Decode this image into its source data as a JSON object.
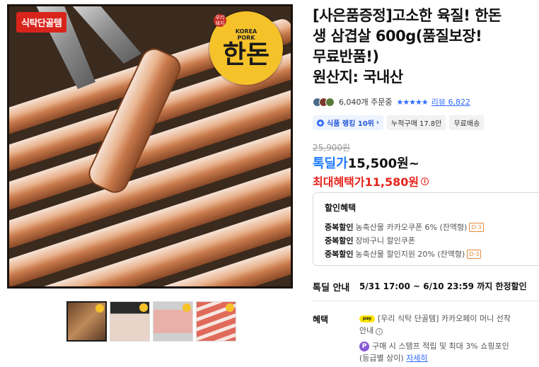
{
  "image": {
    "badge": "식탁단골템",
    "logo_korea": "KOREA",
    "logo_pork": "PORK",
    "logo_name": "한돈",
    "logo_corner": "우리돼지"
  },
  "product": {
    "title_lines": [
      "[사은품증정]고소한 육질! 한돈",
      "생 삼겹살 600g(품질보장!",
      "무료반품!)",
      "원산지: 국내산"
    ]
  },
  "reviews": {
    "order_count": "6,040개 주문중",
    "stars": "★★★★★",
    "review_link": "리뷰 6,822"
  },
  "tags": {
    "rank": "식품 랭킹 10위",
    "rank_arrow": "›",
    "cumulative": "누적구매 17.8만",
    "shipping": "무료배송"
  },
  "price": {
    "original": "25,900원",
    "deal_label": "톡딜가",
    "deal_value": "15,500원~",
    "max_label": "최대혜택가",
    "max_value": "11,580원"
  },
  "discount": {
    "header": "할인혜택",
    "rows": [
      {
        "label": "중복할인",
        "text": "농축산물 카카오쿠폰 6% (잔액형)",
        "badge": "D-3"
      },
      {
        "label": "중복할인",
        "text": "장바구니 할인쿠폰",
        "badge": ""
      },
      {
        "label": "중복할인",
        "text": "농축산물 할인지원 20% (잔액형)",
        "badge": "D-3"
      }
    ]
  },
  "deal_notice": {
    "label": "톡딜 안내",
    "value": "5/31 17:00 ~ 6/10 23:59 까지 한정할인"
  },
  "benefits": {
    "label": "혜택",
    "pay_icon": "pay",
    "line1": "[우리 식탁 단골템] 카카오페이 머니 선착",
    "line1b": "안내",
    "p_icon": "P",
    "line2": "구매 시 스탬프 적립 및 최대 3% 쇼핑포인",
    "line2b": "(등급별 상이)",
    "line2_link": "자세히"
  },
  "colors": {
    "accent_blue": "#2f6bff",
    "price_red": "#e5241c",
    "badge_red": "#d9241c",
    "logo_yellow": "#f5c22a"
  }
}
